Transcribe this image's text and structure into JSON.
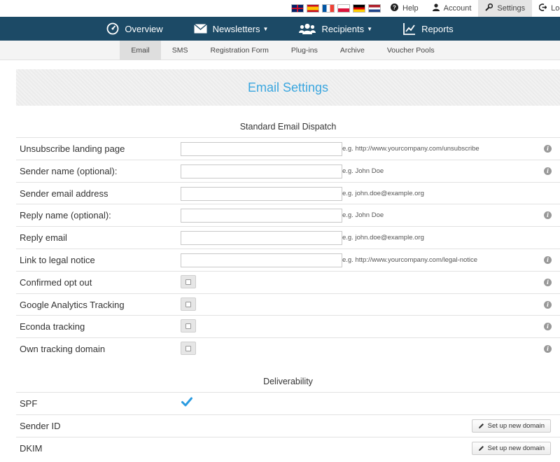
{
  "topbar": {
    "flags": [
      "flag-uk-icon",
      "flag-es-icon",
      "flag-fr-icon",
      "flag-pl-icon",
      "flag-de-icon",
      "flag-nl-icon"
    ],
    "help": "Help",
    "account": "Account",
    "settings": "Settings",
    "logout": "Logout"
  },
  "mainnav": {
    "overview": "Overview",
    "newsletters": "Newsletters",
    "recipients": "Recipients",
    "reports": "Reports"
  },
  "subnav": {
    "email": "Email",
    "sms": "SMS",
    "registration": "Registration Form",
    "plugins": "Plug-ins",
    "archive": "Archive",
    "voucher": "Voucher Pools"
  },
  "page_title": "Email Settings",
  "standard": {
    "title": "Standard Email Dispatch",
    "rows": [
      {
        "label": "Unsubscribe landing page",
        "hint": "e.g. http://www.yourcompany.com/unsubscribe"
      },
      {
        "label": "Sender name (optional):",
        "hint": "e.g. John Doe"
      },
      {
        "label": "Sender email address",
        "hint": "e.g. john.doe@example.org"
      },
      {
        "label": "Reply name (optional):",
        "hint": "e.g. John Doe"
      },
      {
        "label": "Reply email",
        "hint": "e.g. john.doe@example.org"
      },
      {
        "label": "Link to legal notice",
        "hint": "e.g. http://www.yourcompany.com/legal-notice"
      },
      {
        "label": "Confirmed opt out"
      },
      {
        "label": "Google Analytics Tracking"
      },
      {
        "label": "Econda tracking"
      },
      {
        "label": "Own tracking domain"
      }
    ]
  },
  "deliverability": {
    "title": "Deliverability",
    "spf": "SPF",
    "sender_id": "Sender ID",
    "dkim": "DKIM",
    "setup_button": "Set up new domain"
  },
  "colors": {
    "nav_bg": "#1c4a66",
    "accent": "#3aa6df",
    "check": "#2a9be0"
  }
}
